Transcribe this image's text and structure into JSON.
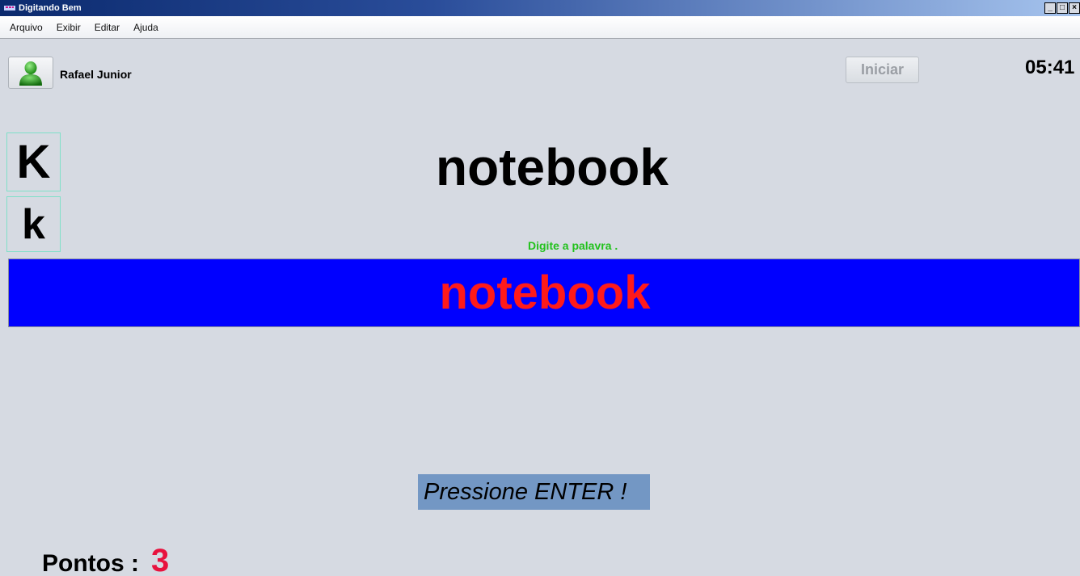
{
  "window": {
    "title": "Digitando Bem",
    "controls": [
      "_",
      "□",
      "×"
    ]
  },
  "menu": [
    "Arquivo",
    "Exibir",
    "Editar",
    "Ajuda"
  ],
  "user": {
    "name": "Rafael Junior"
  },
  "toolbar": {
    "start_label": "Iniciar"
  },
  "timer": "05:41",
  "current_key": {
    "upper": "K",
    "lower": "k"
  },
  "word": {
    "target": "notebook",
    "instruction": "Digite a palavra .",
    "typed": "notebook"
  },
  "prompt": "Pressione ENTER !",
  "score": {
    "label": "Pontos :",
    "value": "3"
  },
  "colors": {
    "typing_band": "#0000ff",
    "typed_text": "#ff1a1a",
    "hint_text": "#22c11c",
    "enter_banner": "#7397c4",
    "score_value": "#e8123e"
  }
}
